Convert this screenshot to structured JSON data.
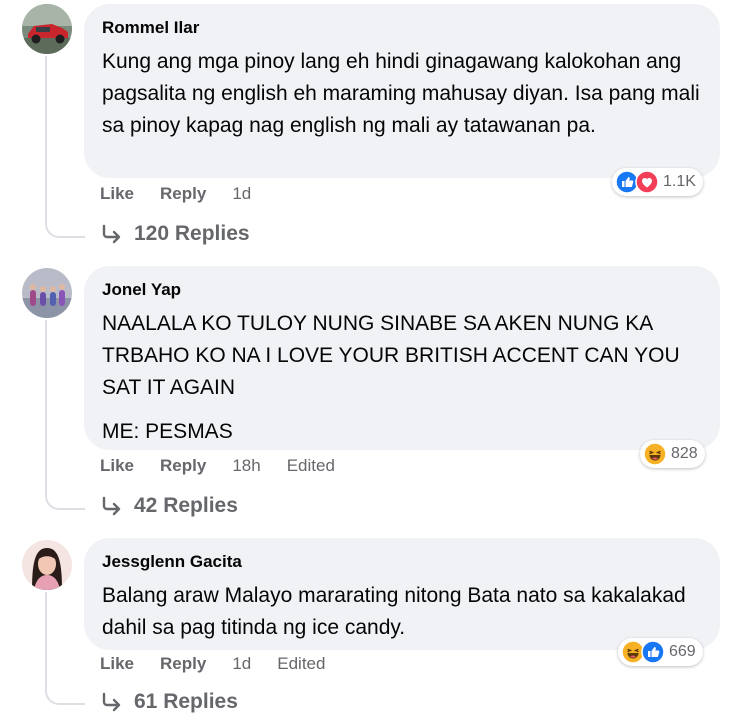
{
  "colors": {
    "bubble_bg": "#f0f2f5",
    "meta_text": "#65676b",
    "like_blue": "#1877f2",
    "love_red": "#f33e58",
    "haha_yellow": "#f7b125"
  },
  "comments": [
    {
      "author": "Rommel Ilar",
      "text": [
        "Kung ang mga pinoy lang eh hindi ginagawang kalokohan ang pagsalita ng english eh maraming mahusay diyan. Isa pang mali sa pinoy kapag nag english ng mali ay tatawanan pa."
      ],
      "like_label": "Like",
      "reply_label": "Reply",
      "time": "1d",
      "edited": "",
      "reaction_icons": [
        "like-icon",
        "love-icon"
      ],
      "reaction_count": "1.1K",
      "replies_label": "120 Replies"
    },
    {
      "author": "Jonel Yap",
      "text": [
        "NAALALA KO TULOY NUNG SINABE SA AKEN NUNG KA TRBAHO KO NA I LOVE YOUR BRITISH ACCENT CAN YOU SAT IT AGAIN",
        "ME: PESMAS"
      ],
      "like_label": "Like",
      "reply_label": "Reply",
      "time": "18h",
      "edited": "Edited",
      "reaction_icons": [
        "haha-icon"
      ],
      "reaction_count": "828",
      "replies_label": "42 Replies"
    },
    {
      "author": "Jessglenn Gacita",
      "text": [
        "Balang araw Malayo mararating nitong Bata nato sa kakalakad dahil sa pag titinda ng ice candy."
      ],
      "like_label": "Like",
      "reply_label": "Reply",
      "time": "1d",
      "edited": "Edited",
      "reaction_icons": [
        "haha-icon",
        "like-icon"
      ],
      "reaction_count": "669",
      "replies_label": "61 Replies"
    }
  ]
}
